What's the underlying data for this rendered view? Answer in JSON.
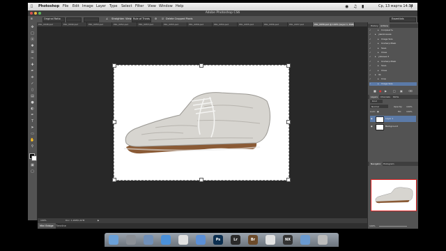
{
  "menubar": {
    "apple": "",
    "items": [
      "Photoshop",
      "File",
      "Edit",
      "Image",
      "Layer",
      "Type",
      "Select",
      "Filter",
      "View",
      "Window",
      "Help"
    ],
    "clock": "Ср, 13 марта 14:34"
  },
  "window_title": "Adobe Photoshop CS6",
  "options": {
    "ratio_select": "Original Ratio",
    "straighten_label": "Straighten",
    "view_label": "View:",
    "view_value": "Rule of Thirds",
    "delete_cropped_label": "Delete Cropped Pixels",
    "workspace_select": "Essentials"
  },
  "doc_tabs": [
    "PRL_0948.psd",
    "PRL_0949.psd",
    "PRL_0950.psd",
    "PRL_0952.psd",
    "PRL_0953.psd",
    "PRL_0955.psd",
    "PRL_0956.psd",
    "PRL_0954.psd",
    "PRL_0955.psd",
    "PRL_0956.psd",
    "PRL_0957.psd",
    "PRL_0958.psd @ 100% (Layer 1, RGB/8)"
  ],
  "status": {
    "zoom": "100%",
    "doc_size": "Doc: 1,29M/1,67M"
  },
  "bottom_tabs": [
    "Mini Bridge",
    "Timeline"
  ],
  "history_tabs": [
    "History",
    "Actions"
  ],
  "actions": [
    {
      "label": "Сохранить",
      "indent": 3
    },
    {
      "label": "увеличение",
      "indent": 2
    },
    {
      "label": "Image Size",
      "indent": 3
    },
    {
      "label": "Unsharp Mask",
      "indent": 3
    },
    {
      "label": "Save",
      "indent": 3
    },
    {
      "label": "Close",
      "indent": 3
    },
    {
      "label": "уменьш 2",
      "indent": 2
    },
    {
      "label": "Unsharp Mask",
      "indent": 3
    },
    {
      "label": "Save",
      "indent": 3
    },
    {
      "label": "Close",
      "indent": 3
    },
    {
      "label": "lib",
      "indent": 2
    },
    {
      "label": "Crop",
      "indent": 3
    },
    {
      "label": "Image Size",
      "indent": 3
    }
  ],
  "layers_tabs": [
    "Layers",
    "Channels",
    "Paths"
  ],
  "layers_kind": "Kind",
  "blend_mode": "Normal",
  "opacity_label": "Opacity:",
  "opacity_value": "100%",
  "lock_label": "Lock:",
  "fill_label": "Fill:",
  "fill_value": "100%",
  "layers": [
    {
      "name": "Layer 1",
      "selected": true
    },
    {
      "name": "Background",
      "selected": false
    }
  ],
  "nav_tabs": [
    "Navigator",
    "Histogram"
  ],
  "nav_zoom": "100%",
  "dock_apps": [
    "Finder",
    "Launchpad",
    "Mail",
    "Safari",
    "iCal",
    "iTunes",
    "Photoshop",
    "Lightroom",
    "Bridge",
    "Chrome",
    "NX2",
    "Preview",
    "Trash"
  ],
  "colors": {
    "accent": "#5b7aa8",
    "panel": "#535353",
    "workspace": "#282828"
  }
}
